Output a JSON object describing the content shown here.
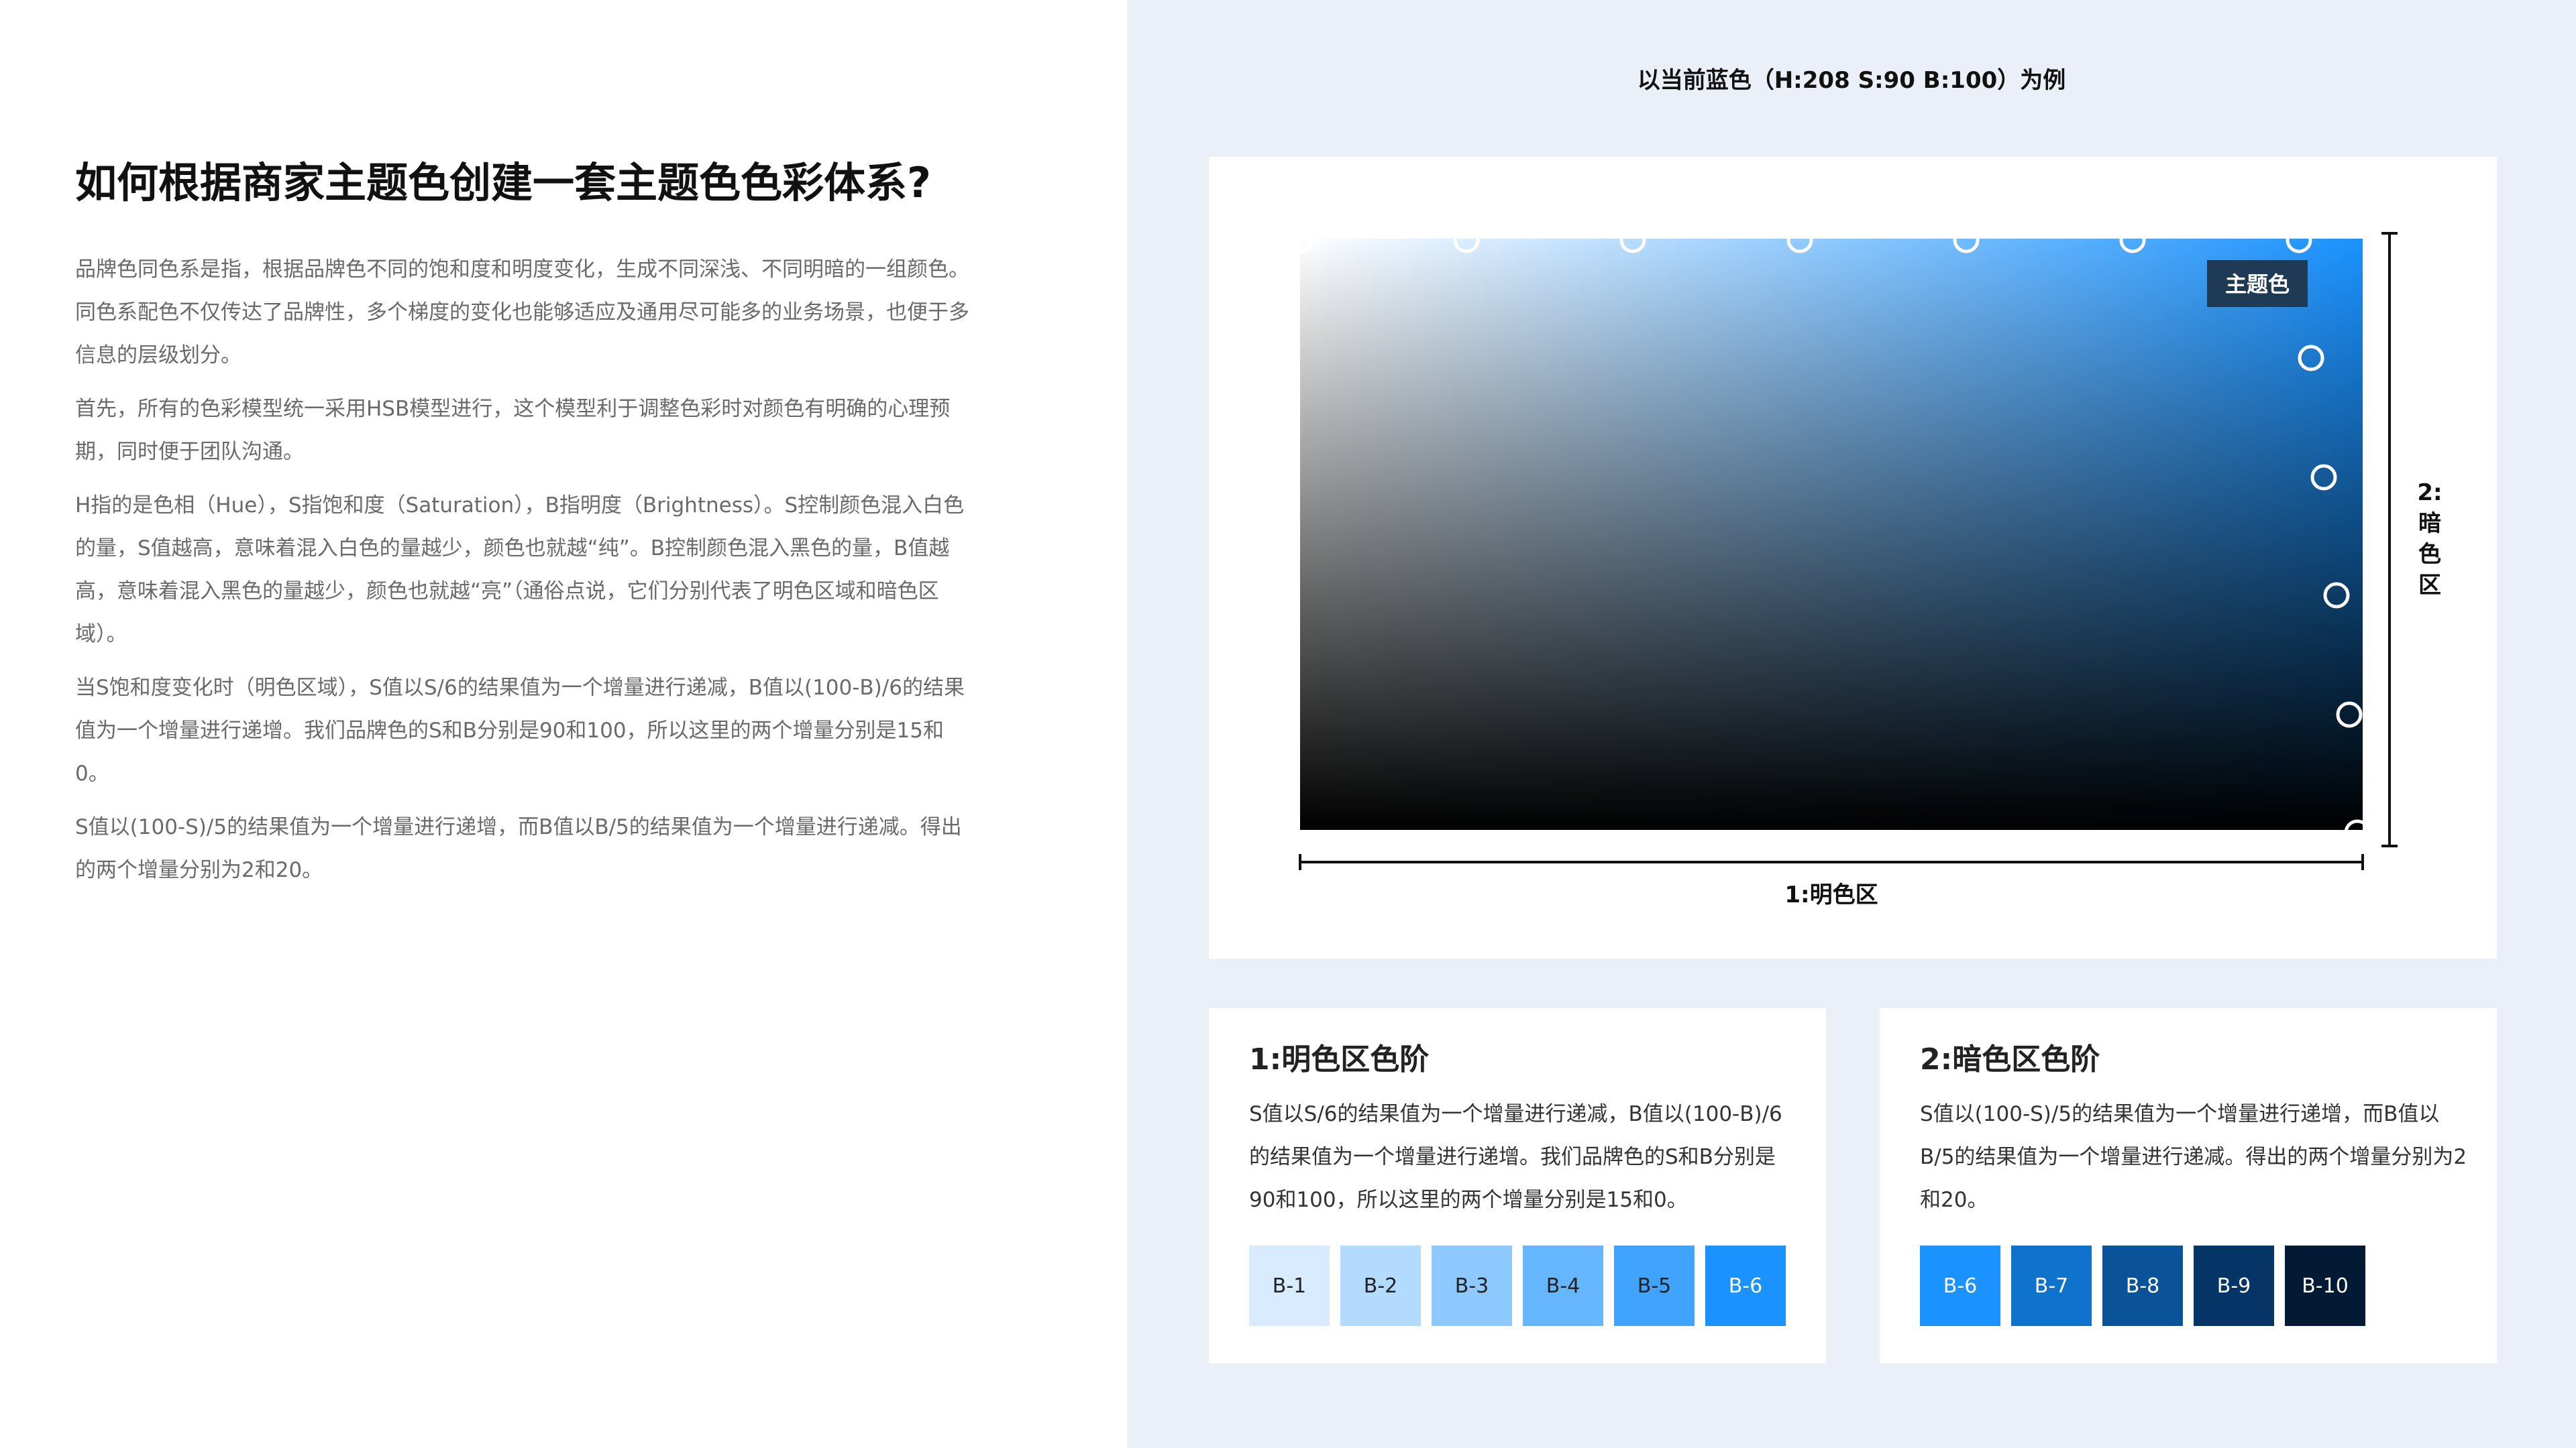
{
  "left": {
    "title": "如何根据商家主题色创建一套主题色色彩体系?",
    "paragraphs": [
      "品牌色同色系是指，根据品牌色不同的饱和度和明度变化，生成不同深浅、不同明暗的一组颜色。同色系配色不仅传达了品牌性，多个梯度的变化也能够适应及通用尽可能多的业务场景，也便于多信息的层级划分。",
      "首先，所有的色彩模型统一采用HSB模型进行，这个模型利于调整色彩时对颜色有明确的心理预期，同时便于团队沟通。",
      "H指的是色相（Hue），S指饱和度（Saturation），B指明度（Brightness）。S控制颜色混入白色的量，S值越高，意味着混入白色的量越少，颜色也就越“纯”。B控制颜色混入黑色的量，B值越高，意味着混入黑色的量越少，颜色也就越“亮”（通俗点说，它们分别代表了明色区域和暗色区域）。",
      "当S饱和度变化时（明色区域），S值以S/6的结果值为一个增量进行递减，B值以(100-B)/6的结果值为一个增量进行递增。我们品牌色的S和B分别是90和100，所以这里的两个增量分别是15和0。",
      "S值以(100-S)/5的结果值为一个增量进行递增，而B值以B/5的结果值为一个增量进行递减。得出的两个增量分别为2和20。"
    ]
  },
  "example": {
    "title": "以当前蓝色（H:208 S:90 B:100）为例"
  },
  "diagram": {
    "theme_label": "主题色",
    "light_zone_label": "1:明色区",
    "dark_zone_label": [
      "2:",
      "暗",
      "色",
      "区"
    ],
    "hue": 208,
    "top_marker_count": 7,
    "right_marker_count": 5,
    "colors": {
      "theme": "#1a92ff",
      "badge_bg": "#1e3a55",
      "marker_stroke": "#ffffff",
      "axis": "#111111"
    }
  },
  "light_card": {
    "title": "1:明色区色阶",
    "text": "S值以S/6的结果值为一个增量进行递减，B值以(100-B)/6的结果值为一个增量进行递增。我们品牌色的S和B分别是90和100，所以这里的两个增量分别是15和0。",
    "swatches": [
      {
        "label": "B-1",
        "color": "#d9ecff",
        "text_color": "#222222"
      },
      {
        "label": "B-2",
        "color": "#b3daff",
        "text_color": "#222222"
      },
      {
        "label": "B-3",
        "color": "#8dc8ff",
        "text_color": "#222222"
      },
      {
        "label": "B-4",
        "color": "#66b6ff",
        "text_color": "#222222"
      },
      {
        "label": "B-5",
        "color": "#40a4ff",
        "text_color": "#222222"
      },
      {
        "label": "B-6",
        "color": "#1a92ff",
        "text_color": "#ffffff"
      }
    ]
  },
  "dark_card": {
    "title": "2:暗色区色阶",
    "text": "S值以(100-S)/5的结果值为一个增量进行递增，而B值以B/5的结果值为一个增量进行递减。得出的两个增量分别为2和20。",
    "swatches": [
      {
        "label": "B-6",
        "color": "#1a92ff",
        "text_color": "#ffffff"
      },
      {
        "label": "B-7",
        "color": "#0f72cc",
        "text_color": "#ffffff"
      },
      {
        "label": "B-8",
        "color": "#0a5399",
        "text_color": "#ffffff"
      },
      {
        "label": "B-9",
        "color": "#053566",
        "text_color": "#ffffff"
      },
      {
        "label": "B-10",
        "color": "#021a33",
        "text_color": "#ffffff"
      }
    ]
  }
}
